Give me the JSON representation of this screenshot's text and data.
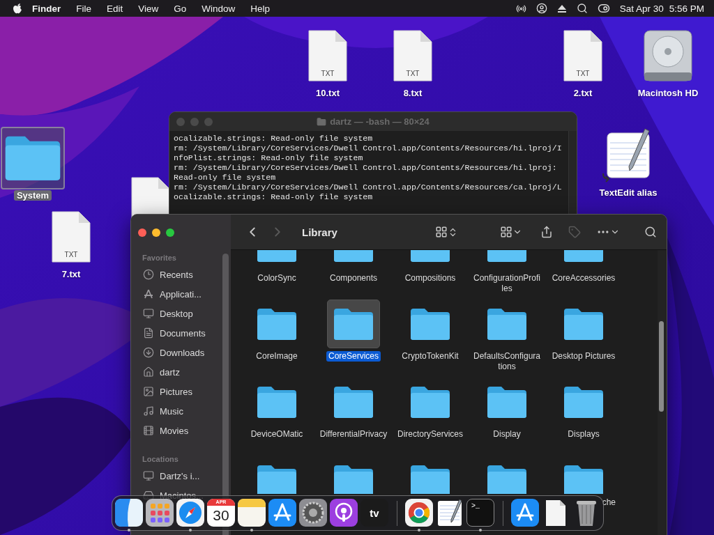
{
  "menu_bar": {
    "menus": [
      "Finder",
      "File",
      "Edit",
      "View",
      "Go",
      "Window",
      "Help"
    ],
    "date": "Sat Apr 30",
    "time": "5:56 PM"
  },
  "desktop_icons": [
    {
      "kind": "file",
      "badge": "TXT",
      "label": "10.txt",
      "selected": false
    },
    {
      "kind": "file",
      "badge": "TXT",
      "label": "8.txt",
      "selected": false
    },
    {
      "kind": "file",
      "badge": "TXT",
      "label": "2.txt",
      "selected": false
    },
    {
      "kind": "disk",
      "label": "Macintosh HD",
      "selected": false
    },
    {
      "kind": "folder",
      "label": "System",
      "selected": true
    },
    {
      "kind": "file",
      "badge": "TXT",
      "label": "7.txt",
      "selected": false
    },
    {
      "kind": "alias",
      "label": "TextEdit alias",
      "selected": false
    },
    {
      "kind": "file"
    }
  ],
  "terminal": {
    "title": "dartz — -bash — 80×24",
    "lines": [
      "ocalizable.strings: Read-only file system",
      "rm: /System/Library/CoreServices/Dwell Control.app/Contents/Resources/hi.lproj/I",
      "nfoPlist.strings: Read-only file system",
      "rm: /System/Library/CoreServices/Dwell Control.app/Contents/Resources/hi.lproj:",
      "Read-only file system",
      "rm: /System/Library/CoreServices/Dwell Control.app/Contents/Resources/ca.lproj/L",
      "ocalizable.strings: Read-only file system"
    ]
  },
  "finder": {
    "title": "Library",
    "back_enabled": true,
    "forward_enabled": false,
    "sidebar": [
      {
        "heading": "Favorites",
        "items": [
          {
            "label": "Recents"
          },
          {
            "label": "Applicati..."
          },
          {
            "label": "Desktop"
          },
          {
            "label": "Documents"
          },
          {
            "label": "Downloads"
          },
          {
            "label": "dartz"
          },
          {
            "label": "Pictures"
          },
          {
            "label": "Music"
          },
          {
            "label": "Movies"
          }
        ]
      },
      {
        "heading": "Locations",
        "items": [
          {
            "label": "Dartz's i..."
          },
          {
            "label": "Macintos..."
          }
        ]
      }
    ],
    "items": [
      {
        "label": "ColorSync",
        "selected": false
      },
      {
        "label": "Components",
        "selected": false
      },
      {
        "label": "Compositions",
        "selected": false
      },
      {
        "label": "ConfigurationProfiles",
        "selected": false
      },
      {
        "label": "CoreAccessories",
        "selected": false
      },
      {
        "label": "CoreImage",
        "selected": false
      },
      {
        "label": "CoreServices",
        "selected": true
      },
      {
        "label": "CryptoTokenKit",
        "selected": false
      },
      {
        "label": "DefaultsConfigurations",
        "selected": false
      },
      {
        "label": "Desktop Pictures",
        "selected": false
      },
      {
        "label": "DeviceOMatic",
        "selected": false
      },
      {
        "label": "DifferentialPrivacy",
        "selected": false
      },
      {
        "label": "DirectoryServices",
        "selected": false
      },
      {
        "label": "Display",
        "selected": false
      },
      {
        "label": "Displays",
        "selected": false
      },
      {
        "selected": false
      },
      {
        "selected": false
      },
      {
        "selected": false
      },
      {
        "selected": false
      },
      {
        "label": "che",
        "selected": false
      }
    ]
  },
  "dock": [
    {
      "kind": "finder",
      "running": true
    },
    {
      "kind": "launchpad",
      "running": false
    },
    {
      "kind": "safari",
      "running": true
    },
    {
      "kind": "calendar",
      "month": "APR",
      "day": "30",
      "running": false
    },
    {
      "kind": "notes",
      "running": true
    },
    {
      "kind": "appstore",
      "running": false
    },
    {
      "kind": "settings",
      "running": false
    },
    {
      "kind": "podcasts",
      "running": false
    },
    {
      "kind": "tv",
      "text": "tv",
      "running": false
    },
    {
      "kind": "separator"
    },
    {
      "kind": "chrome",
      "running": true
    },
    {
      "kind": "textedit",
      "running": false
    },
    {
      "kind": "terminal",
      "text": ">_",
      "running": true
    },
    {
      "kind": "separator"
    },
    {
      "kind": "downloads",
      "running": false
    },
    {
      "kind": "document",
      "running": false
    },
    {
      "kind": "trash",
      "running": false
    }
  ]
}
